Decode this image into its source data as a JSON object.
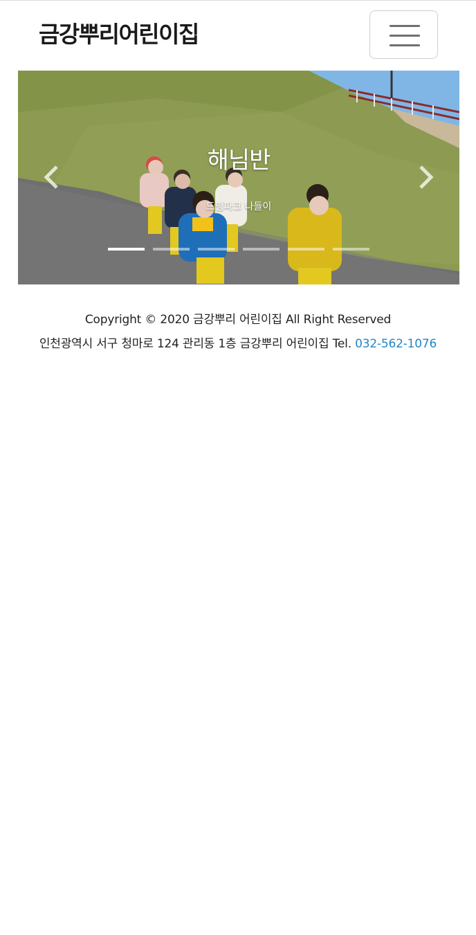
{
  "header": {
    "brand": "금강뿌리어린이집",
    "menu_icon": "hamburger-menu-icon"
  },
  "carousel": {
    "slide_title": "해님반",
    "slide_caption": "드림파크 나들이",
    "prev_icon": "chevron-left-icon",
    "next_icon": "chevron-right-icon",
    "indicator_count": 6,
    "active_index": 0
  },
  "footer": {
    "copyright": "Copyright © 2020 금강뿌리 어린이집 All Right Reserved",
    "address": "인천광역시 서구 청마로 124 관리동 1층 금강뿌리 어린이집 Tel. ",
    "phone": "032-562-1076"
  },
  "colors": {
    "link": "#1f86c8",
    "toggler_border": "#cfcfcf",
    "grass": "#8c9a52",
    "road": "#6f6f6f",
    "sky": "#7fb6e6"
  }
}
